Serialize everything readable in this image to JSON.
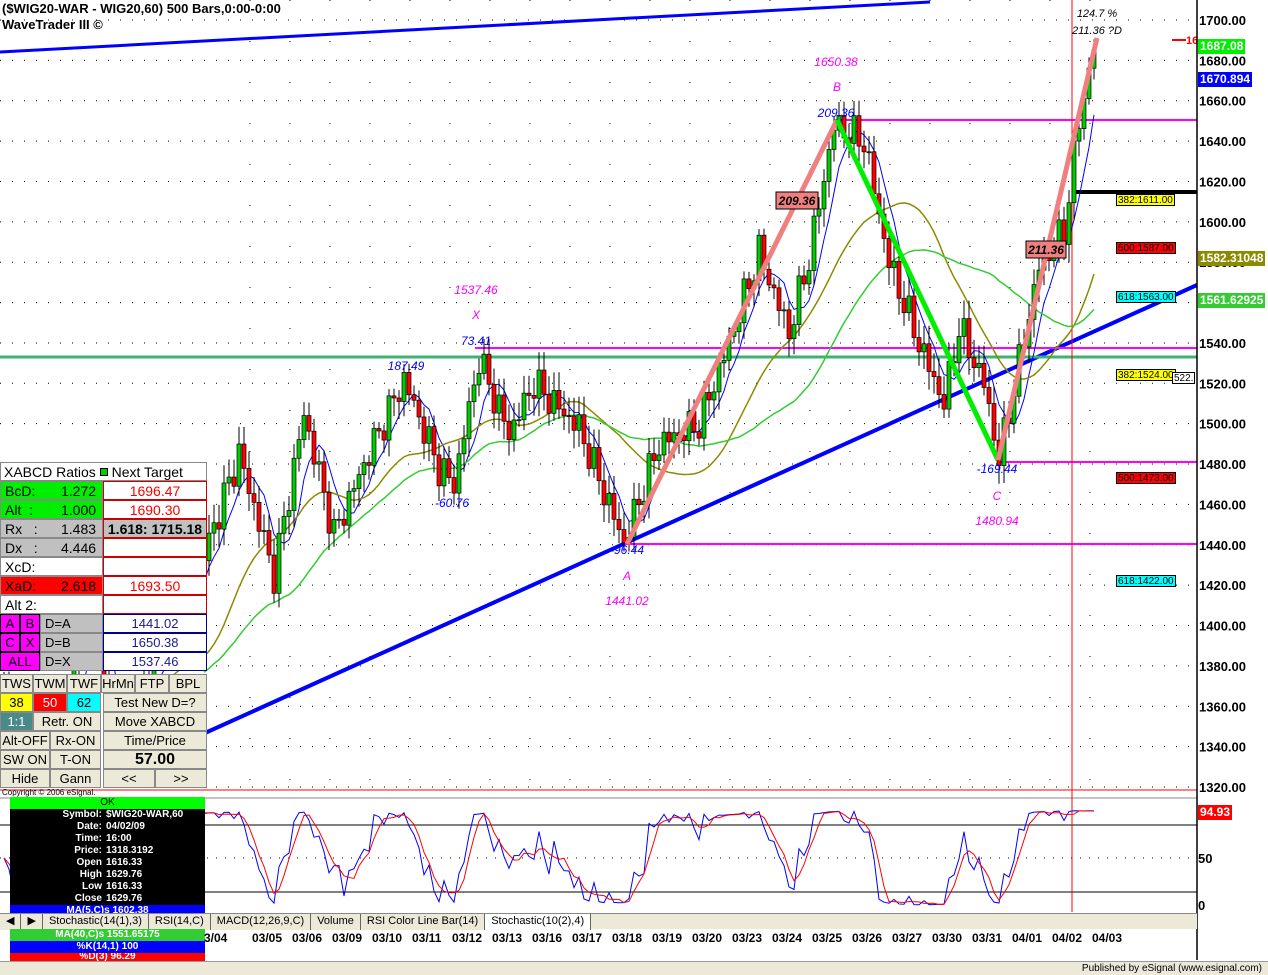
{
  "header": {
    "title": "($WIG20-WAR - WIG20,60) 500 Bars,0:00-0:00",
    "subtitle": "WaveTrader III ©"
  },
  "colors": {
    "up": "#00cc00",
    "down": "#ff0000",
    "magenta": "#ff00ff",
    "blue": "#0000ff",
    "pattern_up": "#f08080",
    "pattern_down": "#00ee00",
    "ma_fast": "#0000ff",
    "ma_mid": "#8b8b00",
    "ma_slow": "#33cc33"
  },
  "chart_data": {
    "type": "candlestick",
    "symbol": "$WIG20-WAR,60",
    "ylim": [
      1310,
      1710
    ],
    "y_ticks": [
      "1700.00",
      "1680.00",
      "1660.00",
      "1640.00",
      "1620.00",
      "1600.00",
      "1580.00",
      "1560.00",
      "1540.00",
      "1520.00",
      "1500.00",
      "1480.00",
      "1460.00",
      "1440.00",
      "1420.00",
      "1400.00",
      "1380.00",
      "1360.00",
      "1340.00",
      "1320.00"
    ],
    "dates": [
      "3/04",
      "03/05",
      "03/06",
      "03/09",
      "03/10",
      "03/11",
      "03/12",
      "03/13",
      "03/16",
      "03/17",
      "03/18",
      "03/19",
      "03/20",
      "03/23",
      "03/24",
      "03/25",
      "03/26",
      "03/27",
      "03/30",
      "03/31",
      "04/01",
      "04/02",
      "04/03"
    ],
    "price_pivots": [
      [
        0,
        1370
      ],
      [
        11,
        1345
      ],
      [
        17,
        1410
      ],
      [
        23,
        1335
      ],
      [
        31,
        1390
      ],
      [
        40,
        1435
      ],
      [
        47,
        1485
      ],
      [
        54,
        1425
      ],
      [
        60,
        1505
      ],
      [
        66,
        1445
      ],
      [
        72,
        1480
      ],
      [
        80,
        1522
      ],
      [
        87,
        1478
      ],
      [
        90,
        1470
      ],
      [
        95,
        1532
      ],
      [
        101,
        1495
      ],
      [
        106,
        1520
      ],
      [
        115,
        1498
      ],
      [
        124,
        1441
      ],
      [
        131,
        1490
      ],
      [
        139,
        1500
      ],
      [
        145,
        1540
      ],
      [
        151,
        1585
      ],
      [
        157,
        1545
      ],
      [
        161,
        1582
      ],
      [
        166,
        1648
      ],
      [
        172,
        1640
      ],
      [
        177,
        1580
      ],
      [
        183,
        1540
      ],
      [
        188,
        1510
      ],
      [
        191,
        1548
      ],
      [
        196,
        1520
      ],
      [
        199,
        1482
      ],
      [
        203,
        1530
      ],
      [
        207,
        1578
      ],
      [
        212,
        1595
      ],
      [
        215,
        1650
      ],
      [
        218,
        1687
      ]
    ],
    "horizontal_levels": {
      "magenta": [
        1650.38,
        1537.46,
        1480.94,
        1441.02
      ],
      "green": 1533,
      "black": 1615
    },
    "pattern_points": {
      "A": 1441.02,
      "B": 1650.38,
      "C": 1480.94,
      "D": 1696
    }
  },
  "annotations": {
    "b_price": "1650.38",
    "b_letter": "B",
    "b_ratio": "209.36",
    "b_box": "209.36",
    "x_price": "1537.46",
    "x_letter": "X",
    "x_ratio": "73.41",
    "swing1": "187.49",
    "swing2": "-60.76",
    "a_ratio": "-96.44",
    "a_letter": "A",
    "a_price": "1441.02",
    "c_ratio": "-169.44",
    "c_letter": "C",
    "c_price": "1480.94",
    "d_pct": "124.7 %",
    "d_label": "211.36 ?D",
    "d_box": "211.36",
    "red_tick": "16"
  },
  "right_labels": {
    "last": "1687.08",
    "ma_fast": "1670.894",
    "ma_mid": "1582.31048",
    "ma_slow": "1561.62925",
    "osc": "94.93",
    "osc_50": "50",
    "osc_0": "0"
  },
  "fibs": [
    {
      "label": "382:1611.00",
      "color": "#ffff00"
    },
    {
      "label": "500:1587.00",
      "color": "#ff0000"
    },
    {
      "label": "618:1563.00",
      "color": "#00ffff"
    },
    {
      "label": "382:1524.00",
      "color": "#ffff00"
    },
    {
      "label": "500:1473.00",
      "color": "#ff0000"
    },
    {
      "label": "618:1422.00",
      "color": "#00ffff"
    }
  ],
  "fib_extra": "522.",
  "panel": {
    "title": "XABCD Ratios",
    "title2": "Next Target",
    "rows": [
      {
        "k": "BcD:",
        "v": "1.272",
        "t": "1696.47"
      },
      {
        "k": "Alt  :",
        "v": "1.000",
        "t": "1690.30"
      },
      {
        "k": "Rx   :",
        "v": "1.483",
        "t": "1.618: 1715.18"
      },
      {
        "k": "Dx   :",
        "v": "4.446",
        "t": ""
      },
      {
        "k": "XcD:",
        "v": "",
        "t": ""
      },
      {
        "k": "XaD:",
        "v": "2.618",
        "t": "1693.50"
      },
      {
        "k": "Alt 2:",
        "v": "",
        "t": ""
      }
    ],
    "pts": [
      {
        "a": "A",
        "b": "B",
        "d": "D=A",
        "t": "1441.02"
      },
      {
        "a": "C",
        "b": "X",
        "d": "D=B",
        "t": "1650.38"
      },
      {
        "a": "ALL",
        "b": "",
        "d": "D=X",
        "t": "1537.46"
      }
    ],
    "buttons": {
      "tws": "TWS",
      "twm": "TWM",
      "twf": "TWF",
      "hrmn": "HrMn",
      "ftp": "FTP",
      "bpl": "BPL",
      "r38": "38",
      "r50": "50",
      "r62": "62",
      "test": "Test New D=?",
      "one": "1:1",
      "retr": "Retr. ON",
      "move": "Move XABCD",
      "altoff": "Alt-OFF",
      "rx": "Rx-ON",
      "tp": "Time/Price",
      "sw": "SW ON",
      "ton": "T-ON",
      "val": "57.00",
      "hide": "Hide",
      "gann": "Gann",
      "prev": "<<",
      "next": ">>"
    }
  },
  "copyright": "Copyright © 2006 eSignal.",
  "data_window": {
    "ok": "OK",
    "rows": [
      [
        "Symbol:",
        "$WIG20-WAR,60"
      ],
      [
        "Date:",
        "04/02/09"
      ],
      [
        "Time:",
        "16:00"
      ],
      [
        "Price:",
        "1318.3192"
      ],
      [
        "Open",
        "1616.33"
      ],
      [
        "High",
        "1629.76"
      ],
      [
        "Low",
        "1616.33"
      ],
      [
        "Close",
        "1629.76"
      ]
    ],
    "ma5": "MA(5,C)s 1602.38",
    "ma40": "MA(40,C)s 1551.65175",
    "k": "%K(14,1) 100",
    "d": "%D(3) 96.29"
  },
  "tabs": [
    "Stochastic(14(1),3)",
    "RSI(14,C)",
    "MACD(12,26,9,C)",
    "Volume",
    "RSI Color Line Bar(14)",
    "Stochastic(10(2),4)"
  ],
  "status": "Published by eSignal (www.esignal.com)"
}
